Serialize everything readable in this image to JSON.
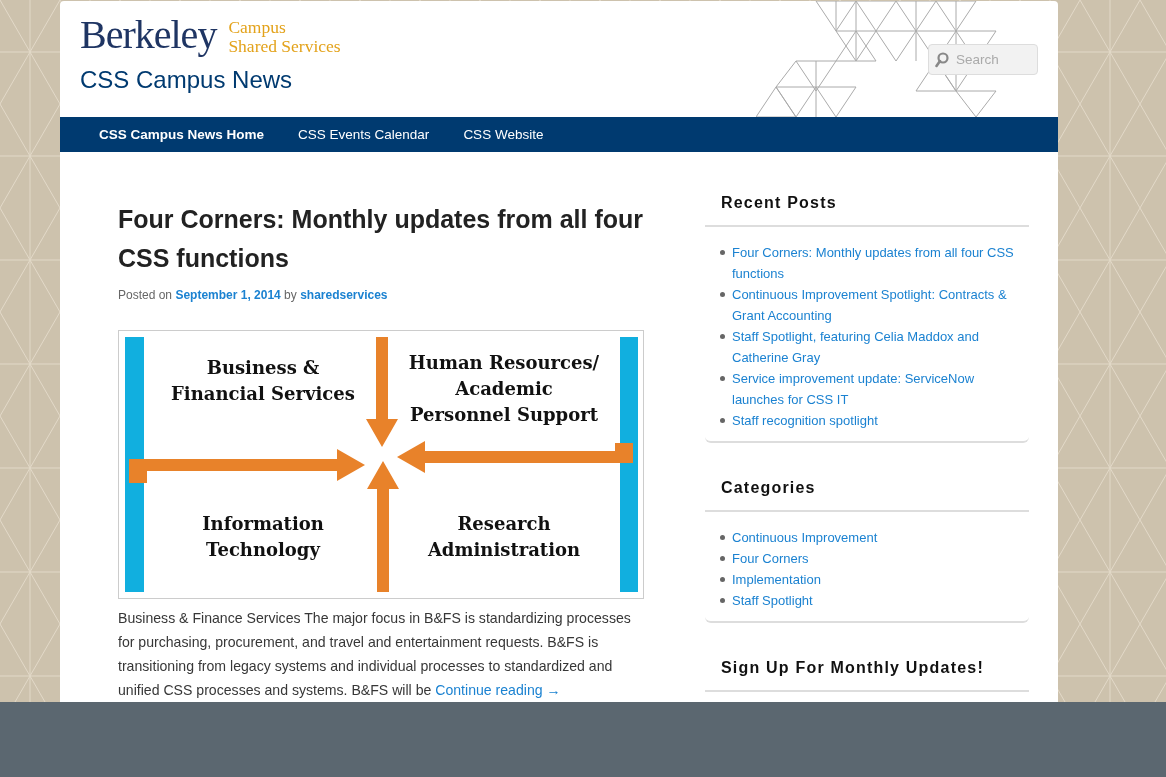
{
  "header": {
    "logo_wordmark": "Berkeley",
    "logo_subtitle": [
      "Campus",
      "Shared Services"
    ],
    "site_title": "CSS Campus News",
    "search": {
      "placeholder": "Search"
    }
  },
  "nav": [
    {
      "label": "CSS Campus News Home",
      "selected": true
    },
    {
      "label": "CSS Events Calendar",
      "selected": false
    },
    {
      "label": "CSS Website",
      "selected": false
    }
  ],
  "post": {
    "title": "Four Corners: Monthly updates from all four CSS functions",
    "meta": {
      "prefix": "Posted on",
      "date": "September 1, 2014",
      "by": "by",
      "author": "sharedservices"
    },
    "figure": {
      "quadrants": [
        [
          "Business &",
          "Financial Services"
        ],
        [
          "Human Resources/",
          "Academic",
          "Personnel Support"
        ],
        [
          "Information",
          "Technology"
        ],
        [
          "Research",
          "Administration"
        ]
      ]
    },
    "excerpt": "Business & Finance Services The major focus in B&FS is standardizing processes for purchasing, procurement, and travel and entertainment requests.  B&FS is transitioning from legacy systems and individual processes to standardized and unified CSS processes and systems. B&FS will be",
    "continue_link": "Continue reading →"
  },
  "sidebar": [
    {
      "title": "Recent Posts",
      "items": [
        "Four Corners: Monthly updates from all four CSS functions",
        "Continuous Improvement Spotlight: Contracts & Grant Accounting",
        "Staff Spotlight, featuring Celia Maddox and Catherine Gray",
        "Service improvement update: ServiceNow launches for CSS IT",
        "Staff recognition spotlight"
      ]
    },
    {
      "title": "Categories",
      "items": [
        "Continuous Improvement",
        "Four Corners",
        "Implementation",
        "Staff Spotlight"
      ]
    },
    {
      "title": "Sign Up For Monthly Updates!"
    }
  ]
}
